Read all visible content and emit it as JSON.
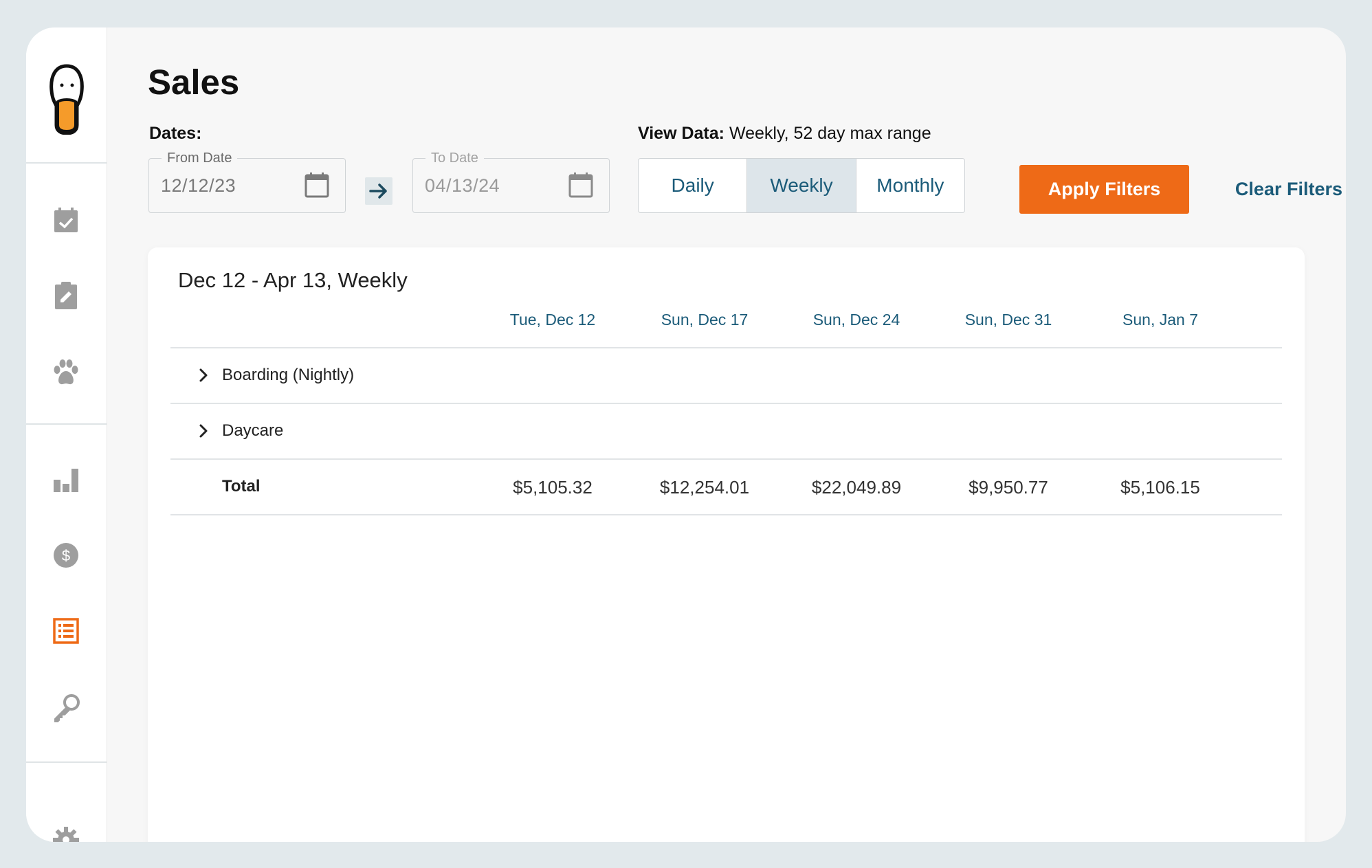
{
  "page": {
    "title": "Sales"
  },
  "filters": {
    "dates_label": "Dates:",
    "from": {
      "legend": "From Date",
      "value": "12/12/23"
    },
    "to": {
      "legend": "To Date",
      "value": "04/13/24"
    },
    "view_label": "View Data:",
    "view_desc": "Weekly, 52 day max range",
    "options": [
      "Daily",
      "Weekly",
      "Monthly"
    ],
    "selected": "Weekly",
    "apply_label": "Apply Filters",
    "clear_label": "Clear Filters"
  },
  "sidebar": {
    "icons": [
      "logo-icon",
      "calendar-check-icon",
      "clipboard-edit-icon",
      "paw-icon",
      "bar-chart-icon",
      "dollar-icon",
      "report-list-icon",
      "key-icon",
      "gear-icon"
    ],
    "active": "report-list-icon"
  },
  "table": {
    "title": "Dec 12 - Apr 13, Weekly",
    "columns": [
      "Tue, Dec 12",
      "Sun, Dec 17",
      "Sun, Dec 24",
      "Sun, Dec 31",
      "Sun, Jan 7"
    ],
    "rows": [
      {
        "label": "Boarding (Nightly)",
        "expandable": true,
        "values": []
      },
      {
        "label": "Daycare",
        "expandable": true,
        "values": []
      },
      {
        "label": "Total",
        "expandable": false,
        "values": [
          "$5,105.32",
          "$12,254.01",
          "$22,049.89",
          "$9,950.77",
          "$5,106.15"
        ]
      }
    ]
  },
  "colors": {
    "accent": "#ee6a17",
    "link": "#1b5b79",
    "icon": "#9e9e9e"
  }
}
